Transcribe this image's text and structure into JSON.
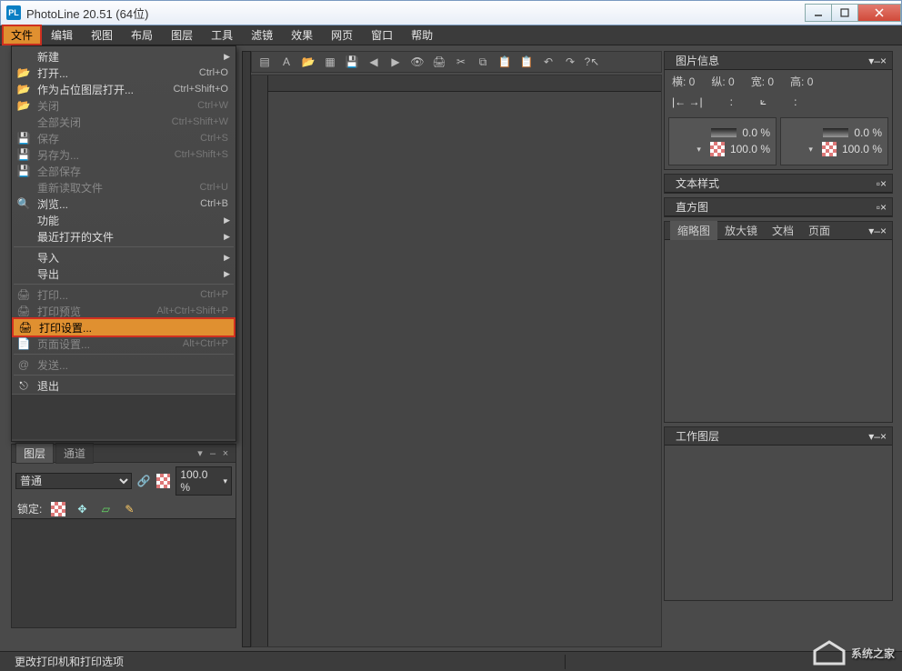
{
  "window": {
    "title": "PhotoLine 20.51 (64位)",
    "app_badge": "PL"
  },
  "menubar": [
    "文件",
    "编辑",
    "视图",
    "布局",
    "图层",
    "工具",
    "滤镜",
    "效果",
    "网页",
    "窗口",
    "帮助"
  ],
  "file_menu": {
    "groups": [
      [
        {
          "icon": "",
          "label": "新建",
          "shortcut": "",
          "arrow": true
        },
        {
          "icon": "folder",
          "label": "打开...",
          "shortcut": "Ctrl+O"
        },
        {
          "icon": "folder",
          "label": "作为占位图层打开...",
          "shortcut": "Ctrl+Shift+O"
        },
        {
          "icon": "folder",
          "label": "关闭",
          "shortcut": "Ctrl+W",
          "disabled": true
        },
        {
          "icon": "",
          "label": "全部关闭",
          "shortcut": "Ctrl+Shift+W",
          "disabled": true
        },
        {
          "icon": "save",
          "label": "保存",
          "shortcut": "Ctrl+S",
          "disabled": true
        },
        {
          "icon": "save",
          "label": "另存为...",
          "shortcut": "Ctrl+Shift+S",
          "disabled": true
        },
        {
          "icon": "save",
          "label": "全部保存",
          "disabled": true
        },
        {
          "icon": "",
          "label": "重新读取文件",
          "shortcut": "Ctrl+U",
          "disabled": true
        },
        {
          "icon": "browse",
          "label": "浏览...",
          "shortcut": "Ctrl+B"
        },
        {
          "icon": "",
          "label": "功能",
          "arrow": true
        },
        {
          "icon": "",
          "label": "最近打开的文件",
          "arrow": true
        }
      ],
      [
        {
          "icon": "",
          "label": "导入",
          "arrow": true
        },
        {
          "icon": "",
          "label": "导出",
          "arrow": true
        }
      ],
      [
        {
          "icon": "print",
          "label": "打印...",
          "shortcut": "Ctrl+P",
          "disabled": true
        },
        {
          "icon": "print",
          "label": "打印预览",
          "shortcut": "Alt+Ctrl+Shift+P",
          "disabled": true
        },
        {
          "icon": "print",
          "label": "打印设置...",
          "highlight": true
        },
        {
          "icon": "page",
          "label": "页面设置...",
          "shortcut": "Alt+Ctrl+P",
          "disabled": true
        }
      ],
      [
        {
          "icon": "mail",
          "label": "发送...",
          "disabled": true
        }
      ],
      [
        {
          "icon": "exit",
          "label": "退出"
        }
      ]
    ]
  },
  "toolbar_icons": [
    "new-doc",
    "text-doc",
    "open",
    "grid",
    "save",
    "prev",
    "play",
    "eye",
    "print",
    "cut",
    "copy",
    "paste",
    "paste2",
    "undo",
    "redo",
    "help-cursor"
  ],
  "layers_panel": {
    "tabs": [
      "图层",
      "通道"
    ],
    "blend": "普通",
    "opacity": "100.0 %",
    "lock_label": "锁定:"
  },
  "right": {
    "imginfo": {
      "title": "图片信息",
      "row1": {
        "w": "横: 0",
        "h": "纵: 0",
        "wide": "宽: 0",
        "tall": "高: 0"
      },
      "arrows": {
        "lr": "|← →|",
        "angle": "⟀"
      },
      "box": {
        "p1": "0.0 %",
        "p2": "100.0 %"
      }
    },
    "textstyle": "文本样式",
    "histogram": "直方图",
    "thumbs_tabs": [
      "缩略图",
      "放大镜",
      "文档",
      "页面"
    ],
    "worklayer": "工作图层"
  },
  "statusbar": {
    "text": "更改打印机和打印选项"
  },
  "watermark": "系统之家"
}
